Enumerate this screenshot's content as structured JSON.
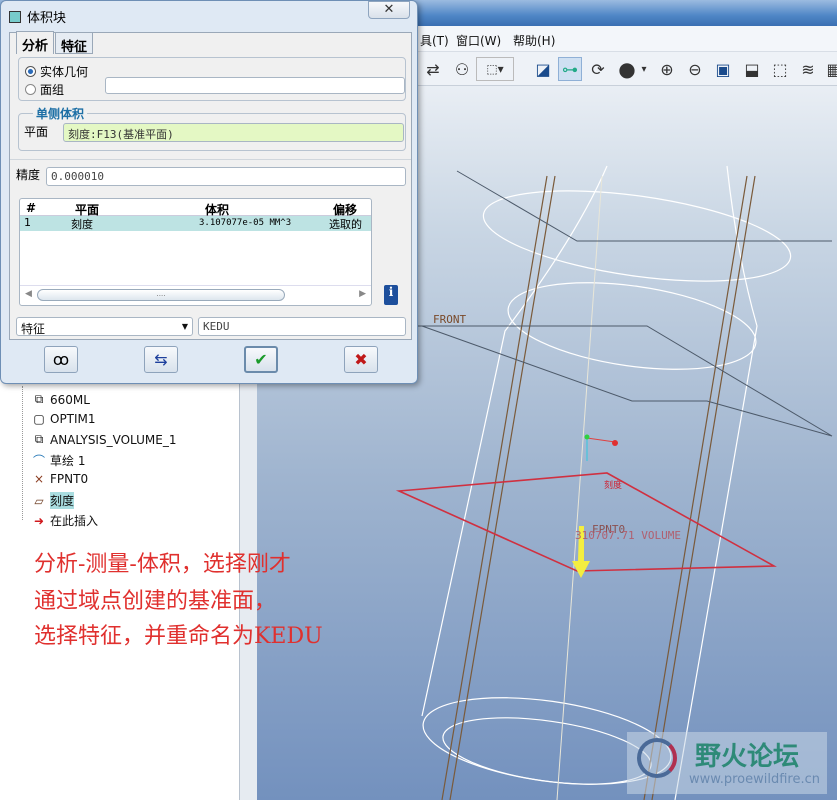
{
  "menu": [
    "具(T)",
    "窗口(W)",
    "帮助(H)"
  ],
  "tree": [
    {
      "icon": "analysis-feature-icon",
      "label": "660ML"
    },
    {
      "icon": "optimization-icon",
      "label": "OPTIM1"
    },
    {
      "icon": "analysis-feature-icon",
      "label": "ANALYSIS_VOLUME_1"
    },
    {
      "icon": "sketch-icon",
      "label": "草绘 1"
    },
    {
      "icon": "datum-point-icon",
      "label": "FPNT0"
    },
    {
      "icon": "datum-plane-icon",
      "label": "刻度"
    },
    {
      "icon": "insert-here-arrow-icon",
      "label": "在此插入"
    }
  ],
  "dialog": {
    "title": "体积块",
    "tabs": [
      "分析",
      "特征"
    ],
    "radio_solid": "实体几何",
    "radio_quilt": "面组",
    "group_title": "单侧体积",
    "plane_label": "平面",
    "plane_value": "刻度:F13(基准平面)",
    "precision_label": "精度",
    "precision_value": "0.000010",
    "table": {
      "headers": [
        "#",
        "平面",
        "体积",
        "偏移"
      ],
      "rows": [
        [
          "1",
          "刻度",
          "3.107077e-05 MM^3",
          "选取的"
        ]
      ]
    },
    "scroll_grip": "....",
    "select_value": "特征",
    "name_value": "KEDU"
  },
  "viewport": {
    "front_label": "FRONT",
    "plane_label": "刻度",
    "point_label": "FPNT0",
    "volume_label": "310707.71 VOLUME"
  },
  "annotation": [
    "分析-测量-体积，选择刚才",
    "通过域点创建的基准面，",
    "选择特征，并重命名为KEDU"
  ],
  "watermark": {
    "title": "野火论坛",
    "url": "www.proewildfire.cn"
  }
}
